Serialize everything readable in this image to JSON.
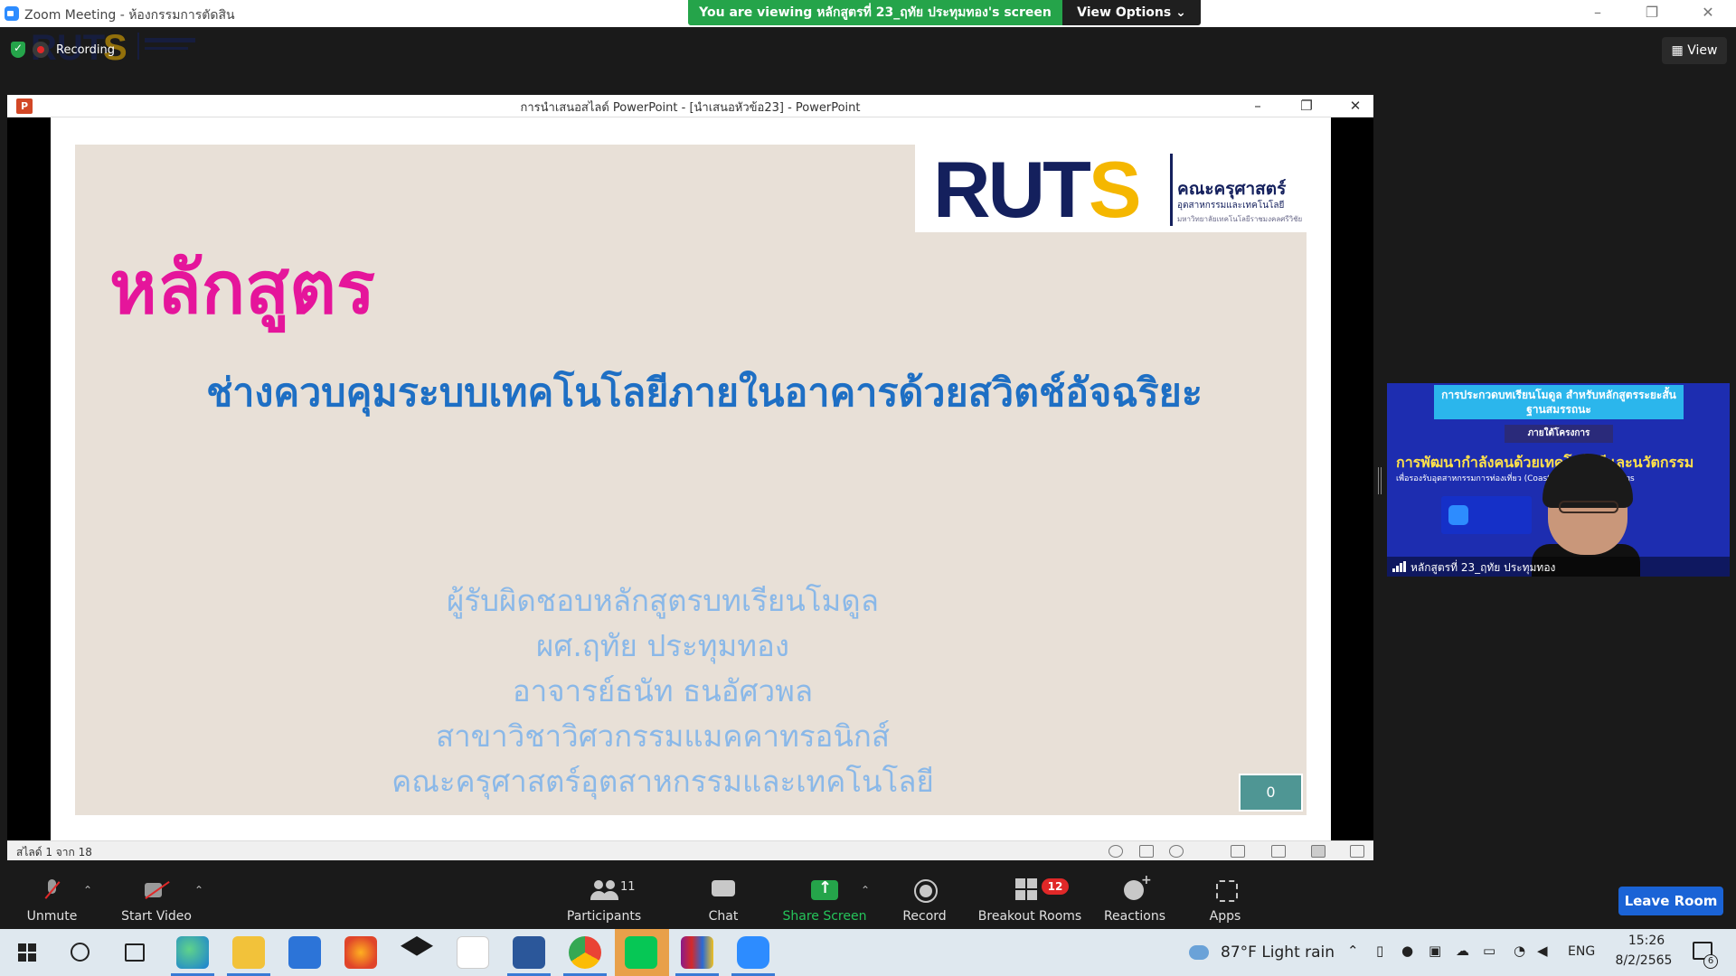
{
  "zoom_window": {
    "title": "Zoom Meeting - ห้องกรรมการตัดสิน",
    "viewing_banner": "You are viewing หลักสูตรที่ 23_ฤทัย ประทุมทอง's screen",
    "view_options": "View Options ⌄",
    "recording_label": "Recording",
    "view_button": "▦ View",
    "minimize": "–",
    "restore": "❐",
    "close": "✕"
  },
  "powerpoint": {
    "title": "การนำเสนอสไลด์ PowerPoint - [นำเสนอหัวข้อ23] - PowerPoint",
    "icon_letter": "P",
    "minimize": "–",
    "restore": "❐",
    "close": "✕",
    "status": "สไลด์ 1 จาก 18"
  },
  "slide": {
    "logo_text_main": "RUT",
    "logo_text_s": "S",
    "faculty_name": "คณะครุศาสตร์",
    "faculty_sub": "อุตสาหกรรมและเทคโนโลยี",
    "faculty_sub2": "มหาวิทยาลัยเทคโนโลยีราชมงคลศรีวิชัย",
    "heading": "หลักสูตร",
    "course_title": "ช่างควบคุมระบบเทคโนโลยีภายในอาคารด้วยสวิตช์อัจฉริยะ",
    "credits": [
      "ผู้รับผิดชอบหลักสูตรบทเรียนโมดูล",
      "ผศ.ฤทัย ประทุมทอง",
      "อาจารย์ธนัท ธนอัศวพล",
      "สาขาวิชาวิศวกรรมแมคคาทรอนิกส์",
      "คณะครุศาสตร์อุตสาหกรรมและเทคโนโลยี"
    ],
    "counter": "0"
  },
  "video_tile": {
    "banner_1": "การประกวดบทเรียนโมดูล สำหรับหลักสูตรระยะสั้นฐานสมรรถนะ",
    "banner_2": "ภายใต้โครงการ",
    "banner_3": "การพัฒนากำลังคนด้วยเทคโนโลยีและนวัตกรรม",
    "banner_4": "เพื่อรองรับอุตสาหกรรมการท่องเที่ยว (Coastal Tourism) Meetings",
    "participant_name": "หลักสูตรที่ 23_ฤทัย ประทุมทอง"
  },
  "toolbar": {
    "unmute": "Unmute",
    "start_video": "Start Video",
    "participants": "Participants",
    "participants_count": "11",
    "chat": "Chat",
    "share_screen": "Share Screen",
    "record": "Record",
    "breakout_rooms": "Breakout Rooms",
    "breakout_badge": "12",
    "reactions": "Reactions",
    "apps": "Apps",
    "leave_room": "Leave Room",
    "caret": "⌃"
  },
  "taskbar": {
    "weather": "87°F  Light rain",
    "language": "ENG",
    "time": "15:26",
    "date": "8/2/2565",
    "notification_count": "6",
    "apps": [
      "edge",
      "file-explorer",
      "mail",
      "firefox",
      "dropbox",
      "amazon",
      "word",
      "chrome",
      "line",
      "winrar",
      "zoom"
    ]
  },
  "colors": {
    "banner_green": "#25a44a",
    "slide_bg": "#e8e0d7",
    "heading_pink": "#e5159b",
    "title_blue": "#1e6fc4",
    "credit_blue": "#8ab8e8",
    "ruts_navy": "#14205d",
    "ruts_yellow": "#f5b700",
    "leave_blue": "#1a63d6"
  }
}
